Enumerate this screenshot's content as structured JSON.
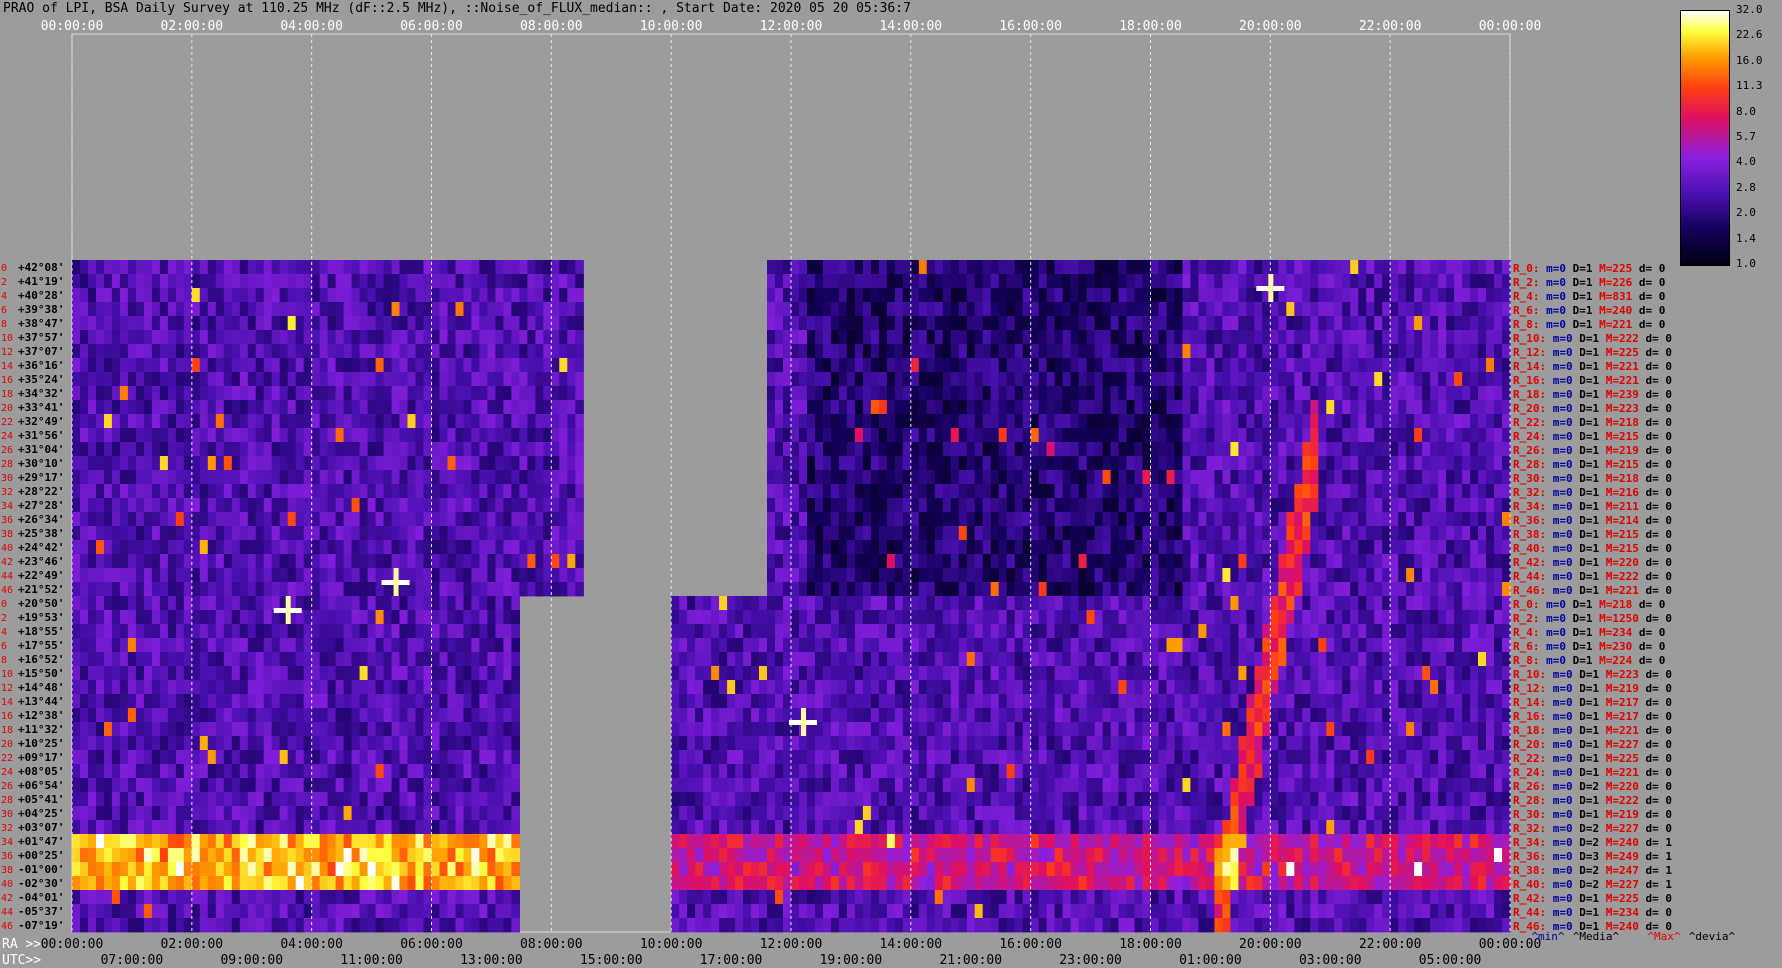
{
  "title": "PRAO of LPI, BSA Daily Survey at 110.25 MHz (dF::2.5 MHz), ::Noise_of_FLUX_median:: , Start Date: 2020 05 20 05:36:7",
  "chart_data": {
    "type": "heatmap",
    "title": "PRAO of LPI, BSA Daily Survey at 110.25 MHz (dF::2.5 MHz), ::Noise_of_FLUX_median:: , Start Date: 2020 05 20 05:36:7",
    "x_top_ticks": [
      "00:00:00",
      "02:00:00",
      "04:00:00",
      "06:00:00",
      "08:00:00",
      "10:00:00",
      "12:00:00",
      "14:00:00",
      "16:00:00",
      "18:00:00",
      "20:00:00",
      "22:00:00",
      "00:00:00"
    ],
    "x_bottom_ra_prefix": "RA >>",
    "x_bottom_ra_ticks": [
      "00:00:00",
      "02:00:00",
      "04:00:00",
      "06:00:00",
      "08:00:00",
      "10:00:00",
      "12:00:00",
      "14:00:00",
      "16:00:00",
      "18:00:00",
      "20:00:00",
      "22:00:00",
      "00:00:00"
    ],
    "x_bottom_utc_prefix": "UTC>>",
    "x_bottom_utc_ticks": [
      "07:00:00",
      "09:00:00",
      "11:00:00",
      "13:00:00",
      "15:00:00",
      "17:00:00",
      "19:00:00",
      "21:00:00",
      "23:00:00",
      "01:00:00",
      "03:00:00",
      "05:00:00"
    ],
    "colorbar": {
      "min": 1.0,
      "max": 32.0,
      "labels": [
        "32.0",
        "22.6",
        "16.0",
        "11.3",
        "8.0",
        "5.7",
        "4.0",
        "2.8",
        "2.0",
        "1.4",
        "1.0"
      ]
    },
    "declinations": [
      "+42°08'",
      "+41°19'",
      "+40°28'",
      "+39°38'",
      "+38°47'",
      "+37°57'",
      "+37°07'",
      "+36°16'",
      "+35°24'",
      "+34°32'",
      "+33°41'",
      "+32°49'",
      "+31°56'",
      "+31°04'",
      "+30°10'",
      "+29°17'",
      "+28°22'",
      "+27°28'",
      "+26°34'",
      "+25°38'",
      "+24°42'",
      "+23°46'",
      "+22°49'",
      "+21°52'",
      "+20°50'",
      "+19°53'",
      "+18°55'",
      "+17°55'",
      "+16°52'",
      "+15°50'",
      "+14°48'",
      "+13°44'",
      "+12°38'",
      "+11°32'",
      "+10°25'",
      "+09°17'",
      "+08°05'",
      "+06°54'",
      "+05°41'",
      "+04°25'",
      "+03°07'",
      "+01°47'",
      "+00°25'",
      "-01°00'",
      "-02°30'",
      "-04°01'",
      "-05°37'",
      "-07°19'"
    ],
    "row_indices": [
      "0",
      "2",
      "4",
      "6",
      "8",
      "10",
      "12",
      "14",
      "16",
      "18",
      "20",
      "22",
      "24",
      "26",
      "28",
      "30",
      "32",
      "34",
      "36",
      "38",
      "40",
      "42",
      "44",
      "46",
      "0",
      "2",
      "4",
      "6",
      "8",
      "10",
      "12",
      "14",
      "16",
      "18",
      "20",
      "22",
      "24",
      "26",
      "28",
      "30",
      "32",
      "34",
      "36",
      "38",
      "40",
      "42",
      "44",
      "46"
    ],
    "row_stats": [
      {
        "r": "R_0:",
        "m": "m=0",
        "D": "D=1",
        "M": "M=225",
        "d": "d= 0"
      },
      {
        "r": "R_2:",
        "m": "m=0",
        "D": "D=1",
        "M": "M=226",
        "d": "d= 0"
      },
      {
        "r": "R_4:",
        "m": "m=0",
        "D": "D=1",
        "M": "M=831",
        "d": "d= 0"
      },
      {
        "r": "R_6:",
        "m": "m=0",
        "D": "D=1",
        "M": "M=240",
        "d": "d= 0"
      },
      {
        "r": "R_8:",
        "m": "m=0",
        "D": "D=1",
        "M": "M=221",
        "d": "d= 0"
      },
      {
        "r": "R_10:",
        "m": "m=0",
        "D": "D=1",
        "M": "M=222",
        "d": "d= 0"
      },
      {
        "r": "R_12:",
        "m": "m=0",
        "D": "D=1",
        "M": "M=225",
        "d": "d= 0"
      },
      {
        "r": "R_14:",
        "m": "m=0",
        "D": "D=1",
        "M": "M=221",
        "d": "d= 0"
      },
      {
        "r": "R_16:",
        "m": "m=0",
        "D": "D=1",
        "M": "M=221",
        "d": "d= 0"
      },
      {
        "r": "R_18:",
        "m": "m=0",
        "D": "D=1",
        "M": "M=239",
        "d": "d= 0"
      },
      {
        "r": "R_20:",
        "m": "m=0",
        "D": "D=1",
        "M": "M=223",
        "d": "d= 0"
      },
      {
        "r": "R_22:",
        "m": "m=0",
        "D": "D=1",
        "M": "M=218",
        "d": "d= 0"
      },
      {
        "r": "R_24:",
        "m": "m=0",
        "D": "D=1",
        "M": "M=215",
        "d": "d= 0"
      },
      {
        "r": "R_26:",
        "m": "m=0",
        "D": "D=1",
        "M": "M=219",
        "d": "d= 0"
      },
      {
        "r": "R_28:",
        "m": "m=0",
        "D": "D=1",
        "M": "M=215",
        "d": "d= 0"
      },
      {
        "r": "R_30:",
        "m": "m=0",
        "D": "D=1",
        "M": "M=218",
        "d": "d= 0"
      },
      {
        "r": "R_32:",
        "m": "m=0",
        "D": "D=1",
        "M": "M=216",
        "d": "d= 0"
      },
      {
        "r": "R_34:",
        "m": "m=0",
        "D": "D=1",
        "M": "M=211",
        "d": "d= 0"
      },
      {
        "r": "R_36:",
        "m": "m=0",
        "D": "D=1",
        "M": "M=214",
        "d": "d= 0"
      },
      {
        "r": "R_38:",
        "m": "m=0",
        "D": "D=1",
        "M": "M=215",
        "d": "d= 0"
      },
      {
        "r": "R_40:",
        "m": "m=0",
        "D": "D=1",
        "M": "M=215",
        "d": "d= 0"
      },
      {
        "r": "R_42:",
        "m": "m=0",
        "D": "D=1",
        "M": "M=220",
        "d": "d= 0"
      },
      {
        "r": "R_44:",
        "m": "m=0",
        "D": "D=1",
        "M": "M=222",
        "d": "d= 0"
      },
      {
        "r": "R_46:",
        "m": "m=0",
        "D": "D=1",
        "M": "M=221",
        "d": "d= 0"
      },
      {
        "r": "R_0:",
        "m": "m=0",
        "D": "D=1",
        "M": "M=218",
        "d": "d= 0"
      },
      {
        "r": "R_2:",
        "m": "m=0",
        "D": "D=1",
        "M": "M=1250",
        "d": "d= 0"
      },
      {
        "r": "R_4:",
        "m": "m=0",
        "D": "D=1",
        "M": "M=234",
        "d": "d= 0"
      },
      {
        "r": "R_6:",
        "m": "m=0",
        "D": "D=1",
        "M": "M=230",
        "d": "d= 0"
      },
      {
        "r": "R_8:",
        "m": "m=0",
        "D": "D=1",
        "M": "M=224",
        "d": "d= 0"
      },
      {
        "r": "R_10:",
        "m": "m=0",
        "D": "D=1",
        "M": "M=223",
        "d": "d= 0"
      },
      {
        "r": "R_12:",
        "m": "m=0",
        "D": "D=1",
        "M": "M=219",
        "d": "d= 0"
      },
      {
        "r": "R_14:",
        "m": "m=0",
        "D": "D=1",
        "M": "M=217",
        "d": "d= 0"
      },
      {
        "r": "R_16:",
        "m": "m=0",
        "D": "D=1",
        "M": "M=217",
        "d": "d= 0"
      },
      {
        "r": "R_18:",
        "m": "m=0",
        "D": "D=1",
        "M": "M=221",
        "d": "d= 0"
      },
      {
        "r": "R_20:",
        "m": "m=0",
        "D": "D=1",
        "M": "M=227",
        "d": "d= 0"
      },
      {
        "r": "R_22:",
        "m": "m=0",
        "D": "D=1",
        "M": "M=225",
        "d": "d= 0"
      },
      {
        "r": "R_24:",
        "m": "m=0",
        "D": "D=1",
        "M": "M=221",
        "d": "d= 0"
      },
      {
        "r": "R_26:",
        "m": "m=0",
        "D": "D=2",
        "M": "M=220",
        "d": "d= 0"
      },
      {
        "r": "R_28:",
        "m": "m=0",
        "D": "D=1",
        "M": "M=222",
        "d": "d= 0"
      },
      {
        "r": "R_30:",
        "m": "m=0",
        "D": "D=1",
        "M": "M=219",
        "d": "d= 0"
      },
      {
        "r": "R_32:",
        "m": "m=0",
        "D": "D=2",
        "M": "M=227",
        "d": "d= 0"
      },
      {
        "r": "R_34:",
        "m": "m=0",
        "D": "D=2",
        "M": "M=240",
        "d": "d= 1"
      },
      {
        "r": "R_36:",
        "m": "m=0",
        "D": "D=3",
        "M": "M=249",
        "d": "d= 1"
      },
      {
        "r": "R_38:",
        "m": "m=0",
        "D": "D=2",
        "M": "M=247",
        "d": "d= 1"
      },
      {
        "r": "R_40:",
        "m": "m=0",
        "D": "D=2",
        "M": "M=227",
        "d": "d= 1"
      },
      {
        "r": "R_42:",
        "m": "m=0",
        "D": "D=1",
        "M": "M=225",
        "d": "d= 0"
      },
      {
        "r": "R_44:",
        "m": "m=0",
        "D": "D=1",
        "M": "M=234",
        "d": "d= 0"
      },
      {
        "r": "R_46:",
        "m": "m=0",
        "D": "D=1",
        "M": "M=240",
        "d": "d= 0"
      }
    ],
    "stats_footer": [
      "^min^",
      "^Media^",
      "^Max^",
      "^devia^"
    ],
    "stats_colors": {
      "r": "#e00000",
      "m": "#0000a0",
      "D": "#000000",
      "M": "#e00000",
      "d": "#000000"
    },
    "data_gaps_hours": [
      [
        8.4,
        11.6
      ],
      [
        10.0,
        12.0
      ]
    ]
  }
}
